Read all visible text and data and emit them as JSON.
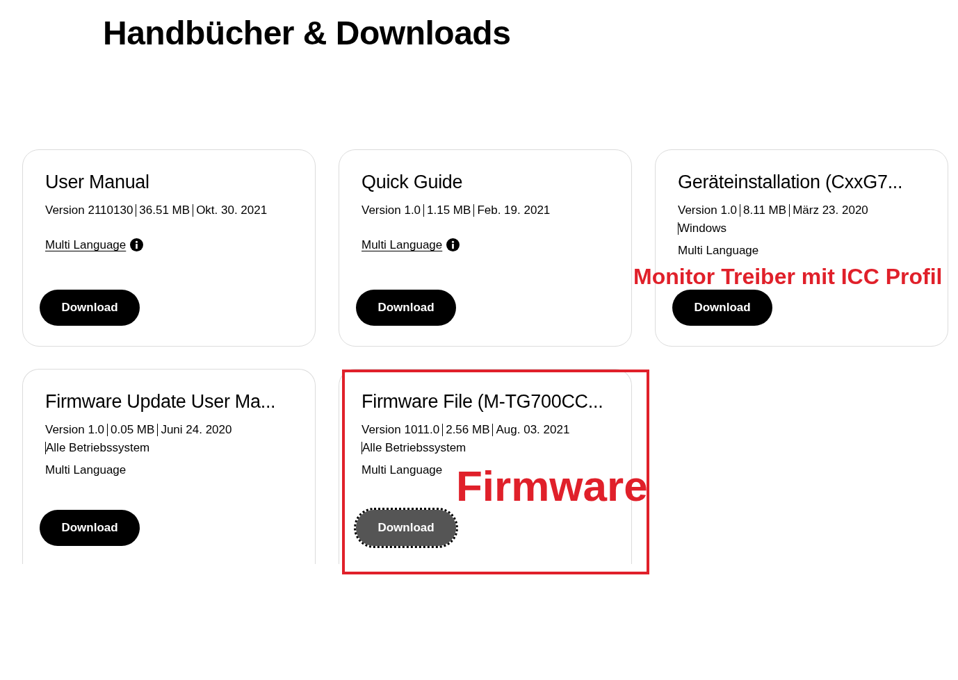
{
  "page_title": "Handbücher & Downloads",
  "cards": [
    {
      "title": "User Manual",
      "meta_lines": [
        [
          "Version 2110130",
          "36.51 MB",
          "Okt. 30. 2021"
        ]
      ],
      "language": {
        "text": "Multi Language",
        "link": true
      },
      "button": {
        "label": "Download",
        "focused": false
      }
    },
    {
      "title": "Quick Guide",
      "meta_lines": [
        [
          "Version 1.0",
          "1.15 MB",
          "Feb. 19. 2021"
        ]
      ],
      "language": {
        "text": "Multi Language",
        "link": true
      },
      "button": {
        "label": "Download",
        "focused": false
      }
    },
    {
      "title": "Geräteinstallation (CxxG7...",
      "meta_lines": [
        [
          "Version 1.0",
          "8.11 MB",
          "März 23. 2020"
        ],
        [
          "Windows"
        ]
      ],
      "language": {
        "text": "Multi Language",
        "link": false
      },
      "button": {
        "label": "Download",
        "focused": false
      },
      "annotation": {
        "text": "Monitor Treiber mit ICC Profil",
        "kind": "note"
      }
    },
    {
      "title": "Firmware Update User Ma...",
      "meta_lines": [
        [
          "Version 1.0",
          "0.05 MB",
          "Juni 24. 2020"
        ],
        [
          "Alle Betriebssystem"
        ]
      ],
      "language": {
        "text": "Multi Language",
        "link": false
      },
      "button": {
        "label": "Download",
        "focused": false
      }
    },
    {
      "title": "Firmware File (M-TG700CC...",
      "meta_lines": [
        [
          "Version 1011.0",
          "2.56 MB",
          "Aug. 03. 2021"
        ],
        [
          "Alle Betriebssystem"
        ]
      ],
      "language": {
        "text": "Multi Language",
        "link": false
      },
      "button": {
        "label": "Download",
        "focused": true
      },
      "annotation": {
        "text": "Firmware",
        "kind": "big"
      },
      "highlighted": true
    }
  ]
}
